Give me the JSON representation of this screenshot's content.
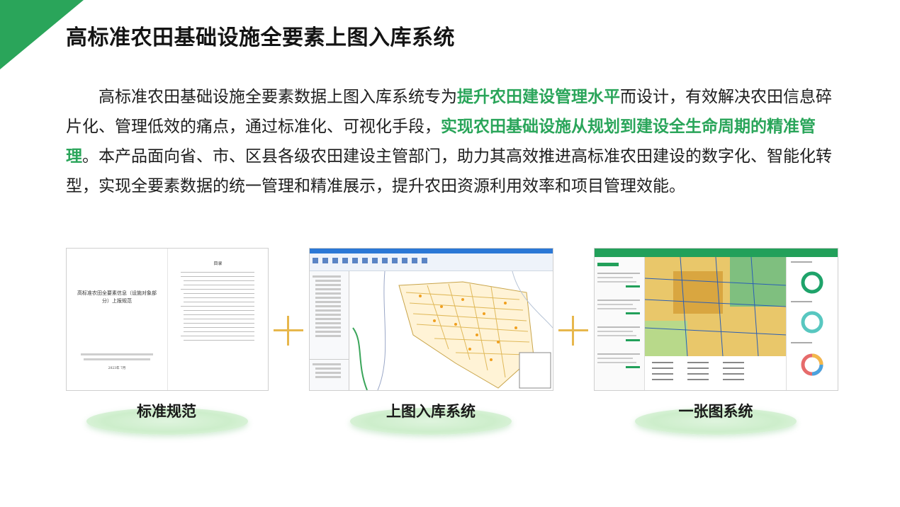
{
  "title": "高标准农田基础设施全要素上图入库系统",
  "intro": {
    "p1": "高标准农田基础设施全要素数据上图入库系统专为",
    "h1": "提升农田建设管理水平",
    "p2": "而设计，有效解决农田信息碎片化、管理低效的痛点，通过标准化、可视化手段，",
    "h2": "实现农田基础设施从规划到建设全生命周期的精准管理",
    "p3": "。本产品面向省、市、区县各级农田建设主管部门，助力其高效推进高标准农田建设的数字化、智能化转型，实现全要素数据的统一管理和精准展示，提升农田资源利用效率和项目管理效能。"
  },
  "products": [
    {
      "label": "标准规范"
    },
    {
      "label": "上图入库系统"
    },
    {
      "label": "一张图系统"
    }
  ],
  "doc": {
    "title": "高标准农田全要素信息（设施对象部分）上报规范",
    "toc_title": "目录",
    "date": "2023年 7月"
  },
  "colors": {
    "accent": "#2aa55a",
    "plus": "#e7b74c"
  }
}
